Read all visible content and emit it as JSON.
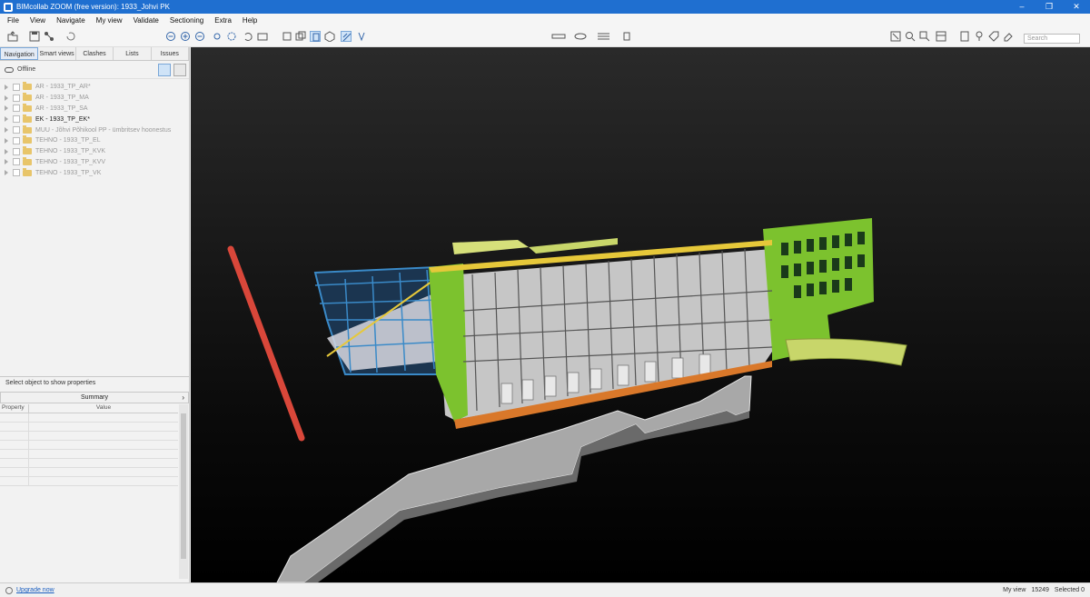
{
  "window": {
    "title": "BIMcollab ZOOM (free version): 1933_Johvi PK",
    "controls": [
      "–",
      "❐",
      "✕"
    ]
  },
  "menu": [
    "File",
    "View",
    "Navigate",
    "My view",
    "Validate",
    "Sectioning",
    "Extra",
    "Help"
  ],
  "toolbar": {
    "search_placeholder": "Search"
  },
  "left_panel": {
    "tabs": [
      "Navigation",
      "Smart views",
      "Clashes",
      "Lists",
      "Issues"
    ],
    "active_tab": "Navigation",
    "offline_label": "Offline",
    "tree": [
      {
        "label": "AR - 1933_TP_AR*",
        "dim": true
      },
      {
        "label": "AR - 1933_TP_MA",
        "dim": true
      },
      {
        "label": "AR - 1933_TP_SA",
        "dim": true
      },
      {
        "label": "EK - 1933_TP_EK*",
        "dim": false
      },
      {
        "label": "MUU - Jõhvi Põhikool PP - ümbritsev hoonestus",
        "dim": true
      },
      {
        "label": "TEHNO - 1933_TP_EL",
        "dim": true
      },
      {
        "label": "TEHNO - 1933_TP_KVK",
        "dim": true
      },
      {
        "label": "TEHNO - 1933_TP_KVV",
        "dim": true
      },
      {
        "label": "TEHNO - 1933_TP_VK",
        "dim": true
      }
    ],
    "properties_header": "Select object to show properties",
    "summary_label": "Summary",
    "columns": [
      "Property",
      "Value"
    ]
  },
  "status": {
    "upgrade": "Upgrade now",
    "view": "My view",
    "count": "15249",
    "selected": "Selected  0"
  },
  "colors": {
    "titlebar": "#1f6fd0",
    "green_facade": "#7cc22e",
    "structure_blue": "#3a8ac8",
    "concrete": "#c8c8c8",
    "red_pipe": "#d9473a",
    "orange_slab": "#d9782a"
  }
}
